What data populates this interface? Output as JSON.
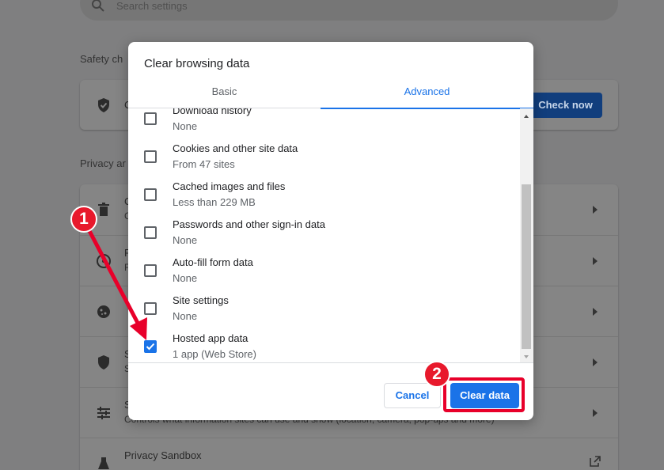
{
  "background": {
    "search_placeholder": "Search settings",
    "safety_check_title": "Safety ch",
    "safety_row_text": "C",
    "check_now_label": "Check now",
    "privacy_title": "Privacy ar",
    "rows": [
      {
        "title": "C",
        "sub": "C"
      },
      {
        "title": "F",
        "sub": "F"
      },
      {
        "title": "",
        "sub": ""
      },
      {
        "title": "S",
        "sub": "S"
      },
      {
        "title": "S",
        "sub": "Controls what information sites can use and show (location, camera, pop-ups and more)"
      }
    ],
    "privacy_sandbox": "Privacy Sandbox"
  },
  "dialog": {
    "title": "Clear browsing data",
    "tabs": [
      "Basic",
      "Advanced"
    ],
    "active_tab": "Advanced",
    "items": [
      {
        "label": "Download history",
        "sub": "None",
        "checked": false
      },
      {
        "label": "Cookies and other site data",
        "sub": "From 47 sites",
        "checked": false
      },
      {
        "label": "Cached images and files",
        "sub": "Less than 229 MB",
        "checked": false
      },
      {
        "label": "Passwords and other sign-in data",
        "sub": "None",
        "checked": false
      },
      {
        "label": "Auto-fill form data",
        "sub": "None",
        "checked": false
      },
      {
        "label": "Site settings",
        "sub": "None",
        "checked": false
      },
      {
        "label": "Hosted app data",
        "sub": "1 app (Web Store)",
        "checked": true
      }
    ],
    "cancel_label": "Cancel",
    "clear_label": "Clear data"
  },
  "annotations": {
    "step1": "1",
    "step2": "2",
    "highlight_color": "#e8002a"
  },
  "colors": {
    "accent": "#1a73e8",
    "overlay": "#7f7f80"
  }
}
